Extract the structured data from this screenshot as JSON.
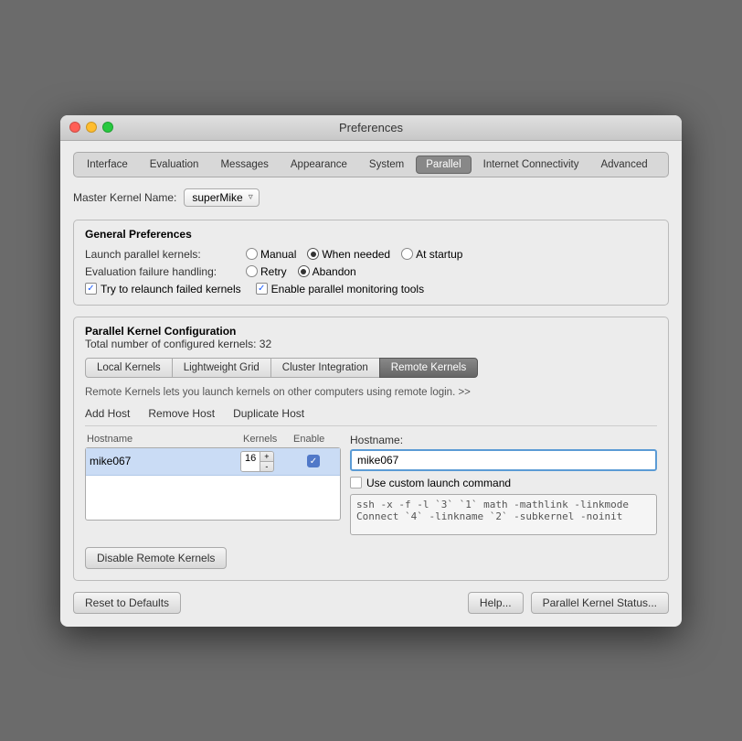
{
  "window": {
    "title": "Preferences"
  },
  "tabs": [
    {
      "id": "interface",
      "label": "Interface",
      "active": false
    },
    {
      "id": "evaluation",
      "label": "Evaluation",
      "active": false
    },
    {
      "id": "messages",
      "label": "Messages",
      "active": false
    },
    {
      "id": "appearance",
      "label": "Appearance",
      "active": false
    },
    {
      "id": "system",
      "label": "System",
      "active": false
    },
    {
      "id": "parallel",
      "label": "Parallel",
      "active": true
    },
    {
      "id": "internet",
      "label": "Internet Connectivity",
      "active": false
    },
    {
      "id": "advanced",
      "label": "Advanced",
      "active": false
    }
  ],
  "masterKernel": {
    "label": "Master Kernel Name:",
    "value": "superMike"
  },
  "generalPrefs": {
    "title": "General Preferences",
    "launchLabel": "Launch parallel kernels:",
    "launchOptions": [
      "Manual",
      "When needed",
      "At startup"
    ],
    "launchSelected": "When needed",
    "failureLabel": "Evaluation failure handling:",
    "failureOptions": [
      "Retry",
      "Abandon"
    ],
    "failureSelected": "Abandon",
    "checkbox1": "Try to relaunch failed kernels",
    "checkbox2": "Enable parallel monitoring tools"
  },
  "parallelConfig": {
    "title": "Parallel Kernel Configuration",
    "subtitle": "Total number of configured kernels: 32",
    "innerTabs": [
      "Local Kernels",
      "Lightweight Grid",
      "Cluster Integration",
      "Remote Kernels"
    ],
    "activeInnerTab": "Remote Kernels",
    "remoteDesc": "Remote Kernels lets you launch kernels on other computers using remote login. >>",
    "actions": [
      "Add Host",
      "Remove Host",
      "Duplicate Host"
    ],
    "listHeaders": {
      "hostname": "Hostname",
      "kernels": "Kernels",
      "enable": "Enable"
    },
    "hosts": [
      {
        "name": "mike067",
        "kernels": 16,
        "enabled": true
      }
    ],
    "detail": {
      "hostnameLabel": "Hostname:",
      "hostnameValue": "mike067",
      "customCmdLabel": "Use custom launch command",
      "cmdText": "ssh -x -f -l `3` `1` math -mathlink -linkmode\nConnect `4` -linkname `2` -subkernel -noinit"
    },
    "disableBtn": "Disable Remote Kernels"
  },
  "bottomBar": {
    "resetBtn": "Reset to Defaults",
    "helpBtn": "Help...",
    "statusBtn": "Parallel Kernel Status..."
  }
}
